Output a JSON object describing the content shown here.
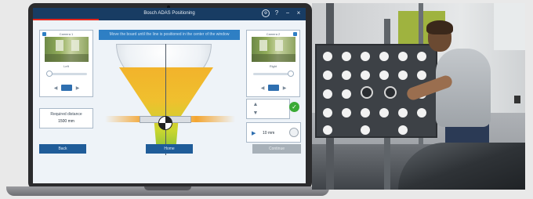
{
  "app": {
    "title": "Bosch ADAS Positioning",
    "info_banner": "Move the board until the line is positioned in the center of the window"
  },
  "titlebar_icons": [
    {
      "name": "settings-icon",
      "glyph": "⚙"
    },
    {
      "name": "help-icon",
      "glyph": "?"
    },
    {
      "name": "minimize-icon",
      "glyph": "−"
    },
    {
      "name": "close-icon",
      "glyph": "×"
    }
  ],
  "camera_left": {
    "label": "Camera 1",
    "sublabel": "Left"
  },
  "camera_right": {
    "label": "Camera 2",
    "sublabel": "Right"
  },
  "distance": {
    "label": "Required distance",
    "value": "1500 mm"
  },
  "measurement": {
    "value": "10 mm"
  },
  "buttons": {
    "back": "Back",
    "home": "Home",
    "continue": "Continue"
  },
  "colors": {
    "titlebar": "#183c63",
    "accent_red": "#e4261d",
    "button_blue": "#1f5c99",
    "banner_blue": "#2e7fc4",
    "ok_green": "#3aaa35",
    "funnel_top": "#f2b32b",
    "funnel_bottom": "#86c13a"
  }
}
